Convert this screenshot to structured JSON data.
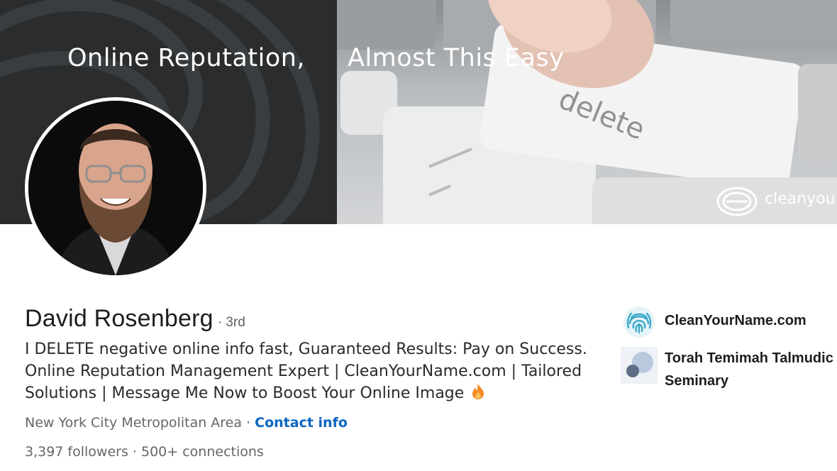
{
  "banner": {
    "headline_left": "Online Reputation,",
    "headline_right": "Almost This Easy",
    "key_label": "delete",
    "brand_text": "cleanyou"
  },
  "profile": {
    "name": "David Rosenberg",
    "degree": "· 3rd",
    "headline": "I DELETE negative online info fast, Guaranteed Results: Pay on Success. Online Reputation Management Expert | CleanYourName.com | Tailored Solutions | Message Me Now to Boost Your Online Image",
    "location": "New York City Metropolitan Area",
    "separator": " · ",
    "contact_info_label": "Contact info",
    "followers": "3,397 followers",
    "stats_separator": " · ",
    "connections": "500+ connections"
  },
  "organizations": [
    {
      "name": "CleanYourName.com",
      "icon": "fingerprint-icon"
    },
    {
      "name": "Torah Temimah Talmudic Seminary",
      "icon": "school-logo-icon"
    }
  ],
  "colors": {
    "link": "#0a66c2",
    "banner_dark": "#2a2c2d",
    "org_logo_teal": "#3aa9c9"
  }
}
